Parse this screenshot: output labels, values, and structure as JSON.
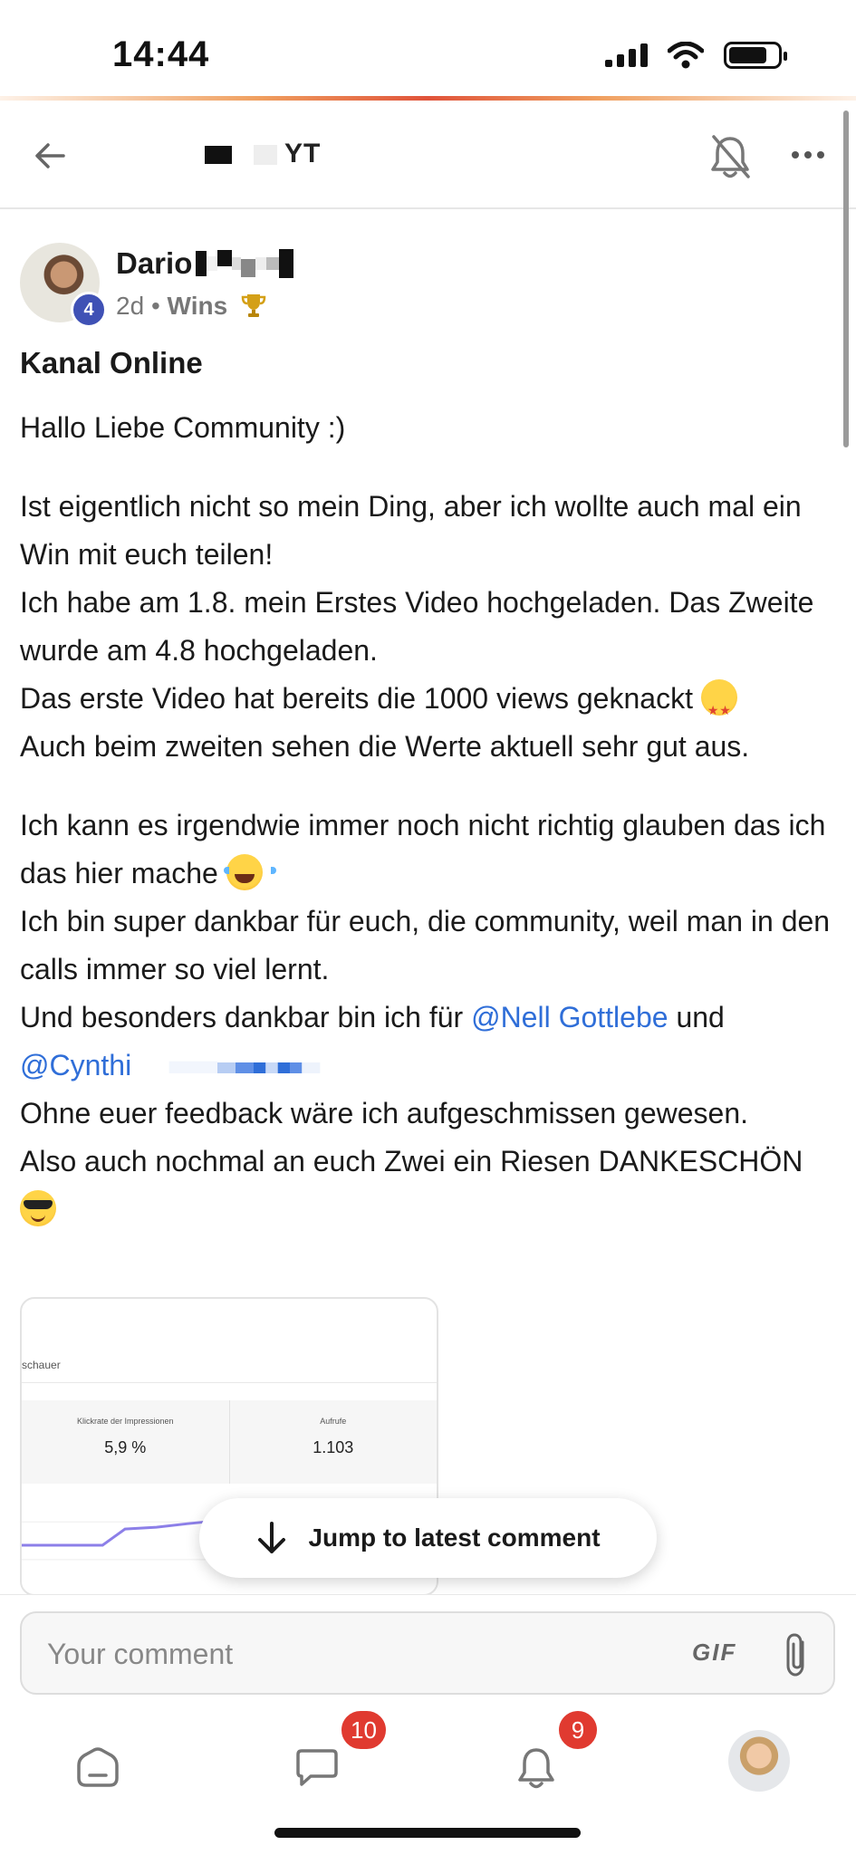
{
  "status_bar": {
    "time": "14:44"
  },
  "header": {
    "title": "YT"
  },
  "post": {
    "author": {
      "name": "Dario",
      "level": "4"
    },
    "meta": {
      "time": "2d",
      "separator": "•",
      "category": "Wins",
      "category_icon": "trophy-icon"
    },
    "title": "Kanal Online",
    "body": {
      "p1": "Hallo Liebe Community :)",
      "p2_l1": "Ist eigentlich nicht so mein Ding, aber ich wollte auch mal ein Win mit euch teilen!",
      "p2_l2": "Ich habe am 1.8. mein Erstes Video hochgeladen. Das Zweite wurde am 4.8 hochgeladen.",
      "p2_l3": "Das erste Video hat bereits die 1000 views geknackt",
      "p2_l4": "Auch beim zweiten sehen die Werte aktuell sehr gut aus.",
      "p3_l1": "Ich kann es irgendwie immer noch nicht richtig glauben das ich das hier mache",
      "p3_l2": "Ich bin super dankbar für euch, die community, weil man in den calls immer so viel lernt.",
      "p3_l3": "Und besonders dankbar bin ich für",
      "mention1": "@Nell Gottlebe",
      "and": "und",
      "mention2": "@Cynthi",
      "p3_l4": "Ohne euer feedback wäre ich aufgeschmissen gewesen.",
      "p3_l5": "Also auch nochmal an euch Zwei ein Riesen DANKESCHÖN"
    },
    "attachment": {
      "label": "schauer",
      "metrics": [
        {
          "label": "Klickrate der Impressionen",
          "value": "5,9 %"
        },
        {
          "label": "Aufrufe",
          "value": "1.103"
        }
      ]
    }
  },
  "jump_button": {
    "label": "Jump to latest comment"
  },
  "composer": {
    "placeholder": "Your comment",
    "gif_label": "GIF"
  },
  "nav": {
    "chat_badge": "10",
    "notifications_badge": "9"
  },
  "colors": {
    "accent": "#2f6ed8",
    "badge": "#e03a30",
    "level_badge": "#3f51b5"
  }
}
